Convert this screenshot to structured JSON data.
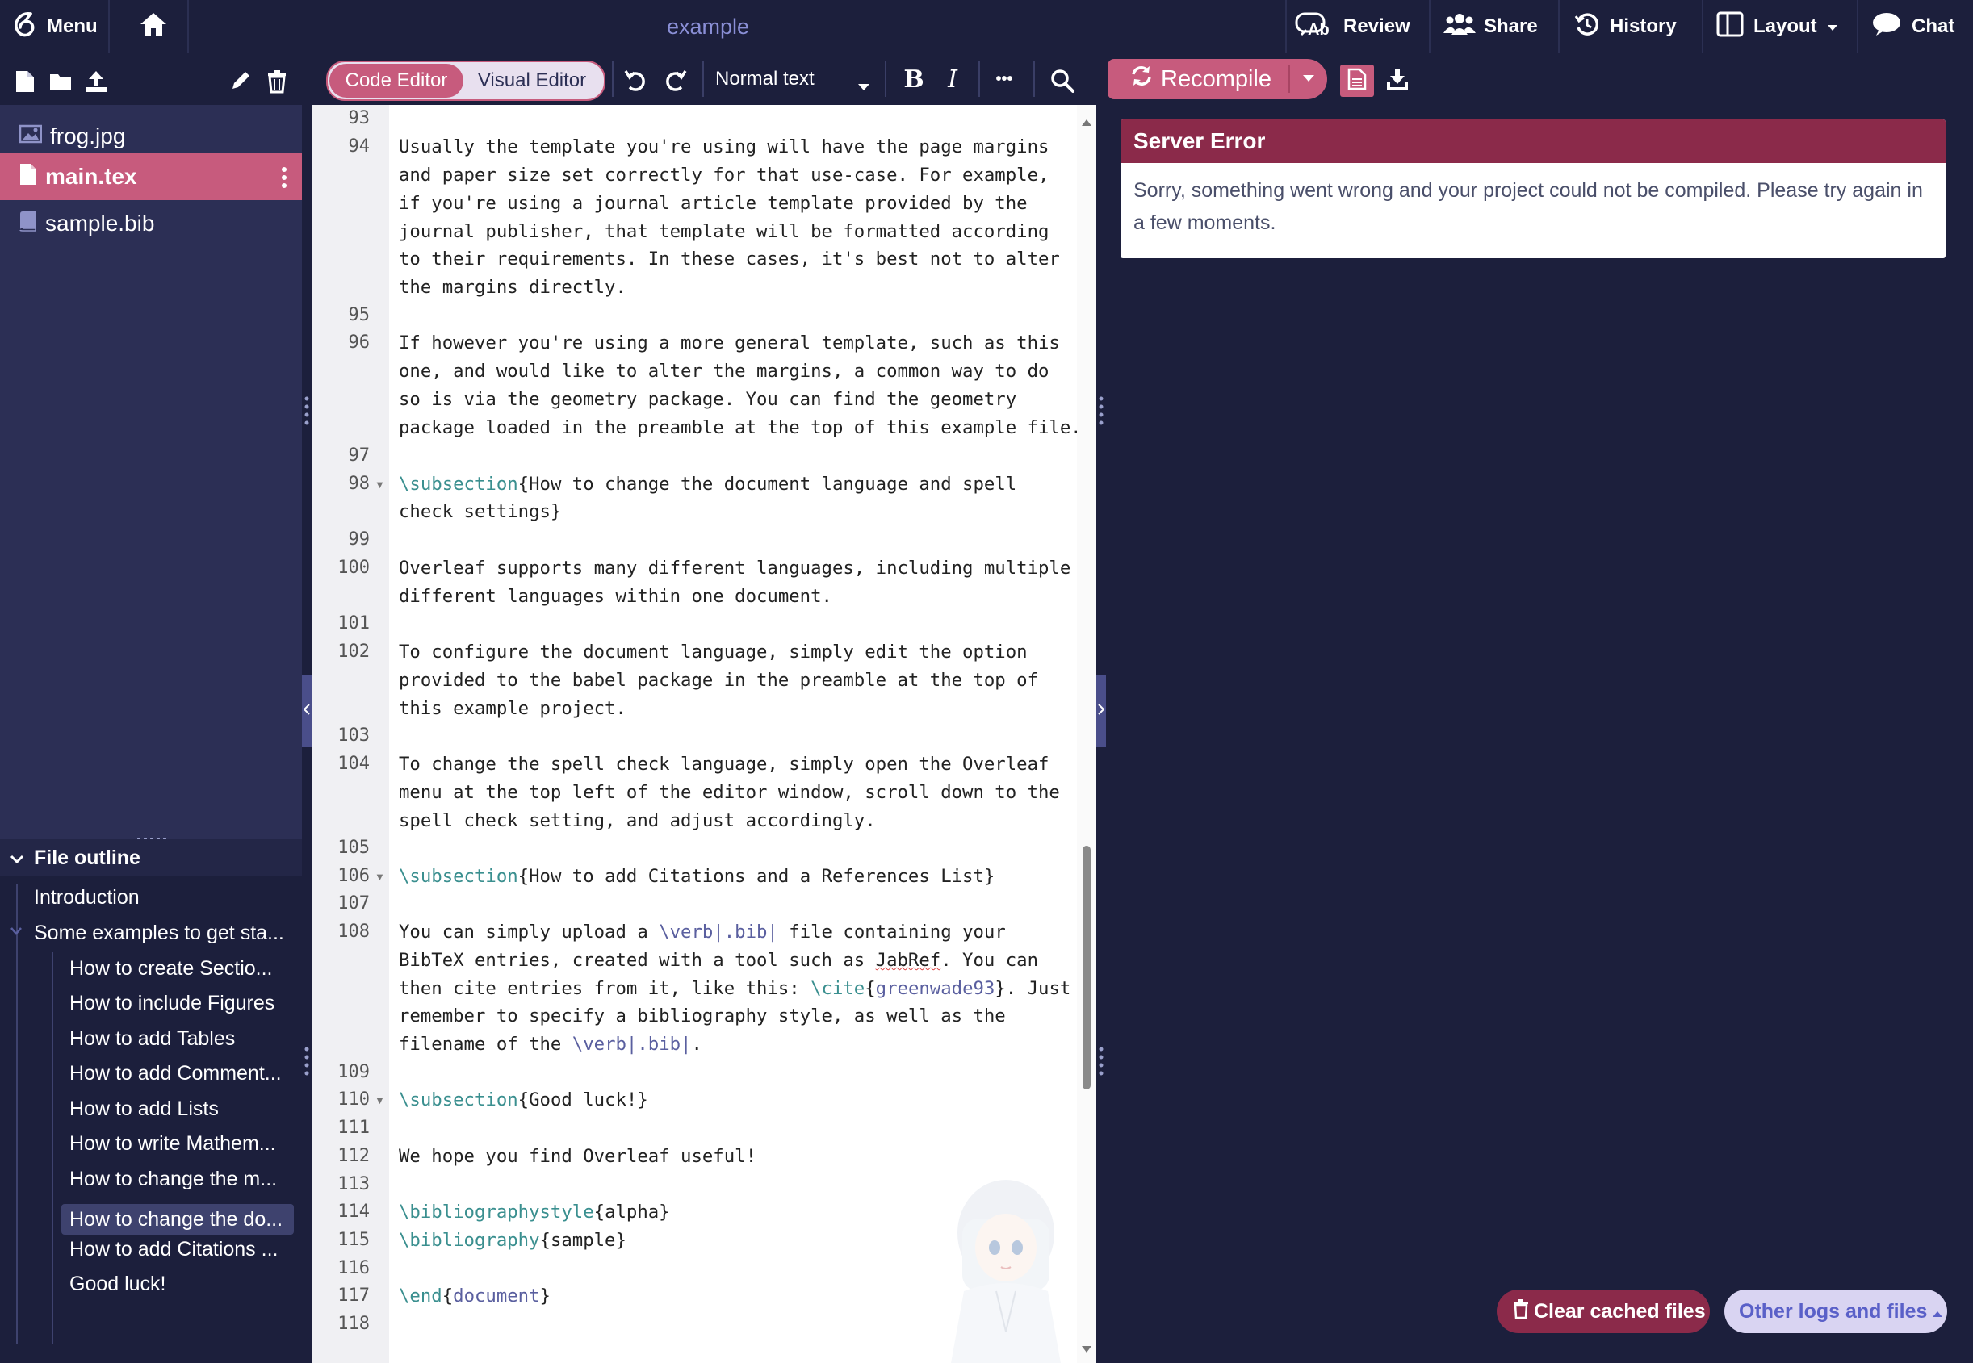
{
  "topbar": {
    "menu_label": "Menu",
    "project_title": "example",
    "review_label": "Review",
    "share_label": "Share",
    "history_label": "History",
    "layout_label": "Layout",
    "chat_label": "Chat"
  },
  "toolbar": {
    "code_editor_label": "Code Editor",
    "visual_editor_label": "Visual Editor",
    "text_style": "Normal text",
    "bold_label": "B",
    "italic_label": "I",
    "more_label": "•••",
    "recompile_label": "Recompile"
  },
  "files": [
    {
      "name": "frog.jpg",
      "icon": "image-icon"
    },
    {
      "name": "main.tex",
      "icon": "file-icon",
      "selected": true
    },
    {
      "name": "sample.bib",
      "icon": "book-icon"
    }
  ],
  "outline": {
    "title": "File outline",
    "items": [
      {
        "label": "Introduction",
        "level": 1
      },
      {
        "label": "Some examples to get sta...",
        "level": 1
      },
      {
        "label": "How to create Sectio...",
        "level": 2
      },
      {
        "label": "How to include Figures",
        "level": 2
      },
      {
        "label": "How to add Tables",
        "level": 2
      },
      {
        "label": "How to add Comment...",
        "level": 2
      },
      {
        "label": "How to add Lists",
        "level": 2
      },
      {
        "label": "How to write Mathem...",
        "level": 2
      },
      {
        "label": "How to change the m...",
        "level": 2
      },
      {
        "label": "How to change the do...",
        "level": 2,
        "selected": true
      },
      {
        "label": "How to add Citations ...",
        "level": 2
      },
      {
        "label": "Good luck!",
        "level": 2
      }
    ]
  },
  "editor": {
    "line_numbers": [
      "93",
      "94",
      "95",
      "96",
      "97",
      "98",
      "99",
      "100",
      "101",
      "102",
      "103",
      "104",
      "105",
      "106",
      "107",
      "108",
      "109",
      "110",
      "111",
      "112",
      "113",
      "114",
      "115",
      "116",
      "117",
      "118"
    ],
    "lines": {
      "l94a": "Usually the template you're using will have the page margins",
      "l94b": "and paper size set correctly for that use-case. For example,",
      "l94c": "if you're using a journal article template provided by the",
      "l94d": "journal publisher, that template will be formatted according",
      "l94e": "to their requirements. In these cases, it's best not to alter",
      "l94f": "the margins directly.",
      "l96a": "If however you're using a more general template, such as this",
      "l96b": "one, and would like to alter the margins, a common way to do",
      "l96c": "so is via the geometry package. You can find the geometry",
      "l96d": "package loaded in the preamble at the top of this example file.",
      "l98cmd": "\\subsection",
      "l98a": "{How to change the document language and spell",
      "l98b": "check settings}",
      "l100a": "Overleaf supports many different languages, including multiple",
      "l100b": "different languages within one document.",
      "l102a": "To configure the document language, simply edit the option",
      "l102b": "provided to the babel package in the preamble at the top of",
      "l102c": "this example project.",
      "l104a": "To change the spell check language, simply open the Overleaf",
      "l104b": "menu at the top left of the editor window, scroll down to the",
      "l104c": "spell check setting, and adjust accordingly.",
      "l106cmd": "\\subsection",
      "l106a": "{How to add Citations and a References List}",
      "l108a1": "You can simply upload a ",
      "l108a2": "\\verb|.bib|",
      "l108a3": " file containing your",
      "l108b1": "BibTeX entries, created with a tool such as ",
      "l108b2": "JabRef",
      "l108b3": ". You can",
      "l108c1": "then cite entries from it, like this: ",
      "l108c2": "\\cite",
      "l108c3": "{",
      "l108c4": "greenwade93",
      "l108c5": "}. Just",
      "l108d": "remember to specify a bibliography style, as well as the",
      "l108e1": "filename of the ",
      "l108e2": "\\verb|.bib|",
      "l108e3": ".",
      "l110cmd": "\\subsection",
      "l110a": "{Good luck!}",
      "l112a": "We hope you find Overleaf useful!",
      "l114cmd": "\\bibliographystyle",
      "l114a": "{alpha}",
      "l115cmd": "\\bibliography",
      "l115a": "{sample}",
      "l117cmd": "\\end",
      "l117a": "{",
      "l117b": "document",
      "l117c": "}"
    }
  },
  "error": {
    "title": "Server Error",
    "message_line1": "Sorry, something went wrong and your project could not be compiled. Please try again in",
    "message_line2": "a few moments."
  },
  "footer": {
    "clear_cache_label": "Clear cached files",
    "other_logs_label": "Other logs and files"
  },
  "colors": {
    "brand_dark": "#1c1f3c",
    "sidebar": "#2c2f55",
    "accent_pink": "#c75b7d",
    "error_header": "#8b2a4a"
  }
}
